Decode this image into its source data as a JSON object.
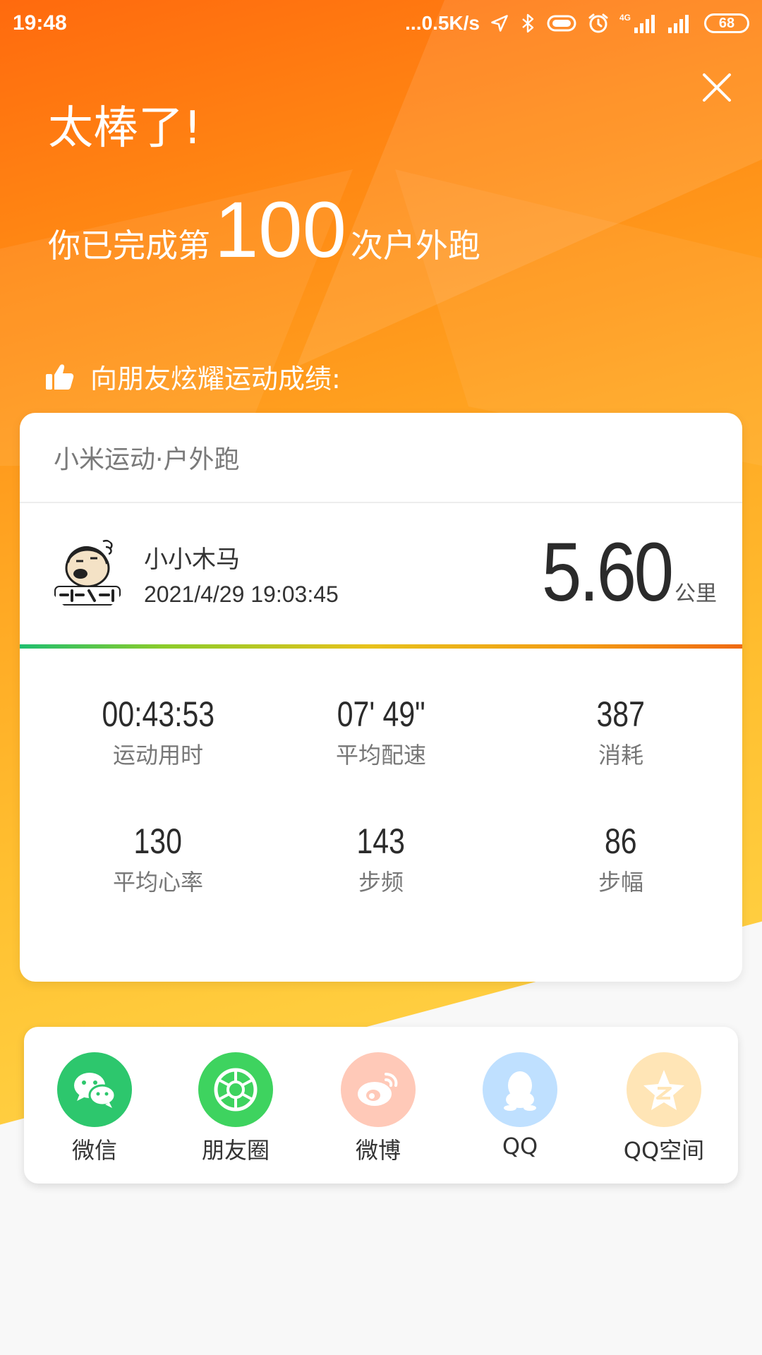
{
  "status_bar": {
    "time": "19:48",
    "network_speed": "...0.5K/s",
    "network_type": "4G",
    "battery": "68"
  },
  "header": {
    "title": "太棒了!",
    "headline_prefix": "你已完成第",
    "count": "100",
    "headline_suffix": "次户外跑",
    "share_prompt": "向朋友炫耀运动成绩:"
  },
  "card": {
    "app_title": "小米运动·户外跑",
    "user_name": "小小木马",
    "datetime": "2021/4/29 19:03:45",
    "distance": "5.60",
    "distance_unit": "公里",
    "stats": [
      {
        "value": "00:43:53",
        "label": "运动用时"
      },
      {
        "value": "07' 49\"",
        "label": "平均配速"
      },
      {
        "value": "387",
        "label": "消耗"
      },
      {
        "value": "130",
        "label": "平均心率"
      },
      {
        "value": "143",
        "label": "步频"
      },
      {
        "value": "86",
        "label": "步幅"
      }
    ]
  },
  "share": {
    "items": [
      {
        "label": "微信",
        "icon": "wechat-icon",
        "color": "#2dc76d"
      },
      {
        "label": "朋友圈",
        "icon": "moments-icon",
        "color": "#3ed35f"
      },
      {
        "label": "微博",
        "icon": "weibo-icon",
        "color": "#ffc9b8"
      },
      {
        "label": "QQ",
        "icon": "qq-icon",
        "color": "#bfe0ff"
      },
      {
        "label": "QQ空间",
        "icon": "qzone-icon",
        "color": "#ffe5b6"
      }
    ]
  },
  "colors": {
    "hero_top": "#ff6a0e",
    "hero_bottom": "#ffd24a",
    "progress_start": "#1fbf6f",
    "progress_end": "#ef6a12"
  }
}
